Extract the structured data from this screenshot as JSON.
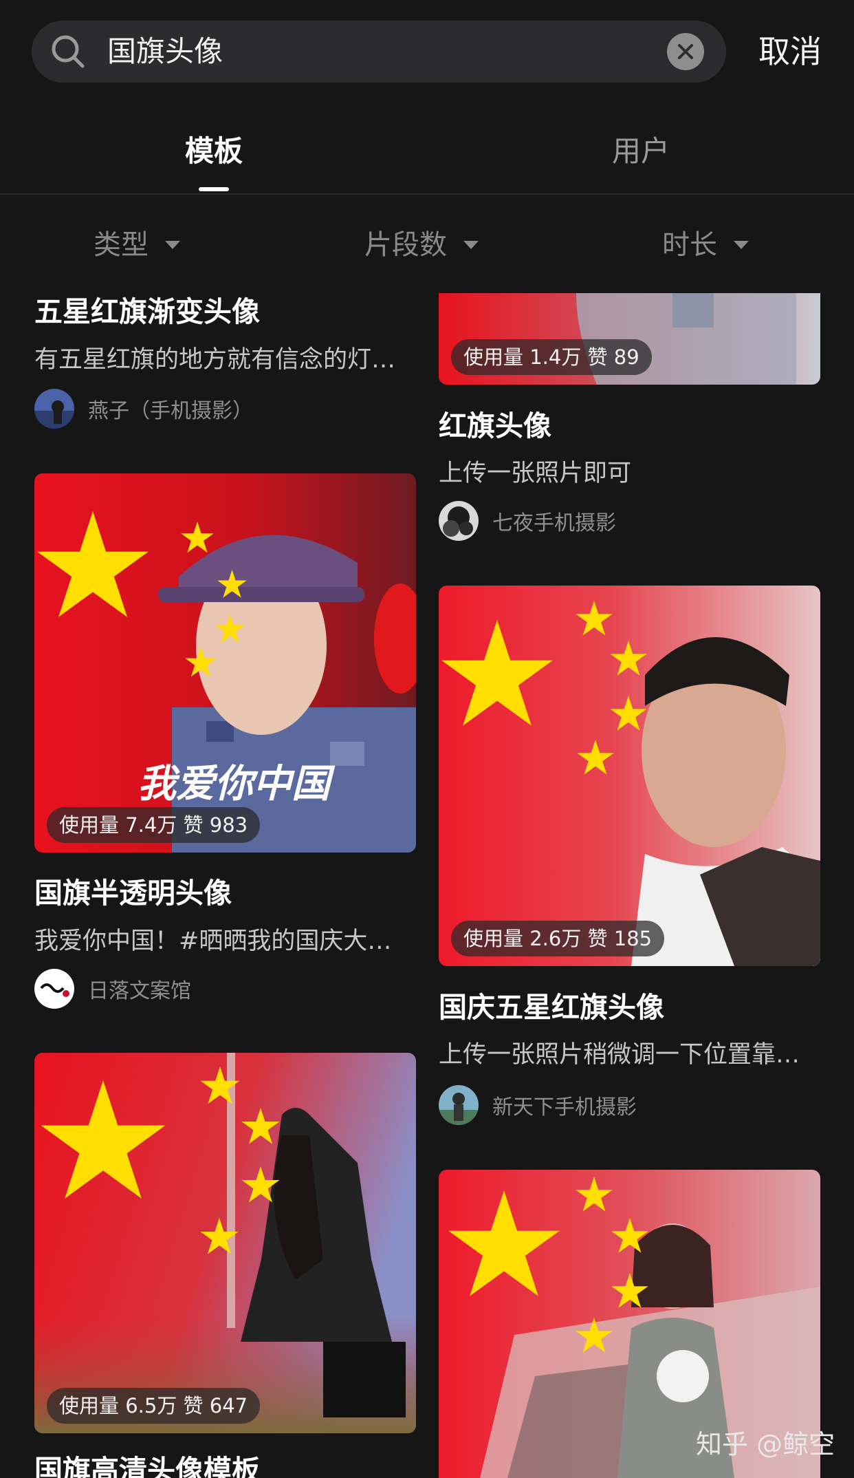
{
  "search": {
    "query": "国旗头像",
    "cancel_label": "取消"
  },
  "tabs": [
    {
      "label": "模板"
    },
    {
      "label": "用户"
    }
  ],
  "filters": [
    {
      "label": "类型"
    },
    {
      "label": "片段数"
    },
    {
      "label": "时长"
    }
  ],
  "cards": [
    {
      "title": "五星红旗渐变头像",
      "desc": "有五星红旗的地方就有信念的灯…",
      "author": "燕子（手机摄影）"
    },
    {
      "stats": "使用量 1.4万 赞 89",
      "title": "红旗头像",
      "desc": "上传一张照片即可",
      "author": "七夜手机摄影"
    },
    {
      "stats": "使用量 7.4万 赞 983",
      "title": "国旗半透明头像",
      "desc": "我爱你中国！#晒晒我的国庆大…",
      "author": "日落文案馆",
      "overlay_text": "我爱你中国"
    },
    {
      "stats": "使用量 2.6万 赞 185",
      "title": "国庆五星红旗头像",
      "desc": "上传一张照片稍微调一下位置靠…",
      "author": "新天下手机摄影"
    },
    {
      "stats": "使用量 6.5万 赞 647",
      "title": "国旗高清头像模板"
    },
    {}
  ],
  "watermark": "知乎 @鲸空",
  "colors": {
    "background": "#161616",
    "flag_red": "#e8121e",
    "star_yellow": "#ffde00",
    "search_bg": "#2c2c2e"
  }
}
